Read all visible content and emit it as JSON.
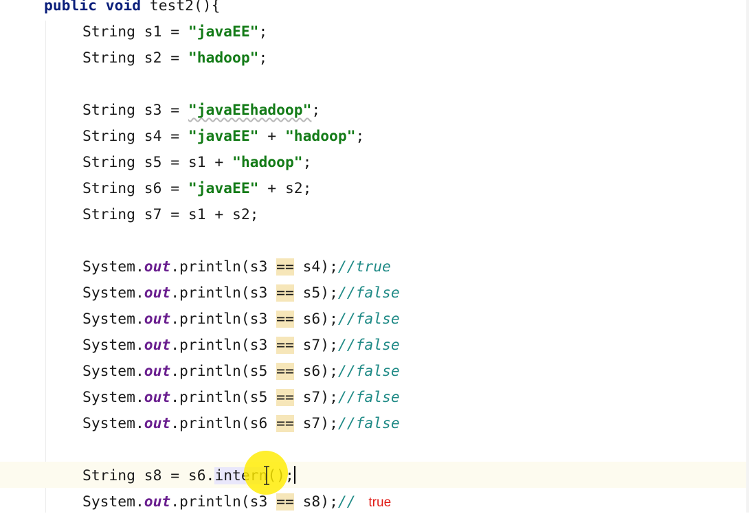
{
  "editor": {
    "method_signature": {
      "modifiers": "public void",
      "rest": " test2(){"
    },
    "declarations": [
      {
        "type": "String",
        "var": "s1",
        "expr": [
          {
            "k": "str",
            "t": "\"javaEE\""
          }
        ]
      },
      {
        "type": "String",
        "var": "s2",
        "expr": [
          {
            "k": "str",
            "t": "\"hadoop\""
          }
        ]
      },
      {
        "type": "String",
        "var": "s3",
        "expr": [
          {
            "k": "str",
            "t": "\"javaEEhadoop\""
          }
        ]
      },
      {
        "type": "String",
        "var": "s4",
        "expr": [
          {
            "k": "str",
            "t": "\"javaEE\""
          },
          {
            "k": "op",
            "t": " + "
          },
          {
            "k": "str",
            "t": "\"hadoop\""
          }
        ]
      },
      {
        "type": "String",
        "var": "s5",
        "expr": [
          {
            "k": "id",
            "t": "s1"
          },
          {
            "k": "op",
            "t": " + "
          },
          {
            "k": "str",
            "t": "\"hadoop\""
          }
        ]
      },
      {
        "type": "String",
        "var": "s6",
        "expr": [
          {
            "k": "str",
            "t": "\"javaEE\""
          },
          {
            "k": "op",
            "t": " + "
          },
          {
            "k": "id",
            "t": "s2"
          }
        ]
      },
      {
        "type": "String",
        "var": "s7",
        "expr": [
          {
            "k": "id",
            "t": "s1"
          },
          {
            "k": "op",
            "t": " + "
          },
          {
            "k": "id",
            "t": "s2"
          }
        ]
      }
    ],
    "comparisons": [
      {
        "left": "s3",
        "right": "s4",
        "comment": "//true"
      },
      {
        "left": "s3",
        "right": "s5",
        "comment": "//false"
      },
      {
        "left": "s3",
        "right": "s6",
        "comment": "//false"
      },
      {
        "left": "s3",
        "right": "s7",
        "comment": "//false"
      },
      {
        "left": "s5",
        "right": "s6",
        "comment": "//false"
      },
      {
        "left": "s5",
        "right": "s7",
        "comment": "//false"
      },
      {
        "left": "s6",
        "right": "s7",
        "comment": "//false"
      }
    ],
    "intern_line": {
      "type": "String",
      "var": "s8",
      "receiver": "s6",
      "method": "intern",
      "tail": "();"
    },
    "final_print": {
      "left": "s3",
      "right": "s8",
      "comment": "//",
      "annotation": "true"
    },
    "tokens": {
      "system": "System",
      "dot": ".",
      "out": "out",
      "println": ".println(",
      "equals": "==",
      "close": ");",
      "assign": " = ",
      "semi": ";"
    }
  },
  "colors": {
    "keyword": "#0a1e7a",
    "string": "#137b17",
    "static_field": "#6a1f8f",
    "comment": "#1f8a86",
    "annotation": "#e01b16",
    "equals_highlight": "#f6e6b9",
    "pointer_halo": "#ffec00"
  },
  "icons": {
    "pointer": "text-cursor-ibeam-icon"
  }
}
